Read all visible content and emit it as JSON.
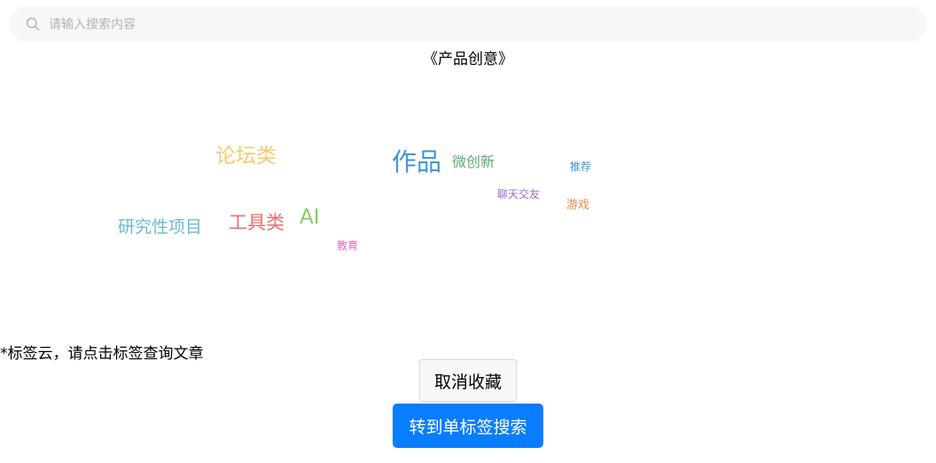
{
  "search": {
    "placeholder": "请输入搜索内容",
    "icon": "search-icon"
  },
  "page_title": "《产品创意》",
  "tag_cloud": {
    "tags": [
      {
        "label": "论坛类",
        "color": "#f8c96b"
      },
      {
        "label": "作品",
        "color": "#3a95e0"
      },
      {
        "label": "微创新",
        "color": "#5aab74"
      },
      {
        "label": "推荐",
        "color": "#3a95e0"
      },
      {
        "label": "聊天交友",
        "color": "#9b6cc4"
      },
      {
        "label": "游戏",
        "color": "#f08a4b"
      },
      {
        "label": "研究性项目",
        "color": "#6bb8d8"
      },
      {
        "label": "工具类",
        "color": "#ee6e6e"
      },
      {
        "label": "AI",
        "color": "#8cc866"
      },
      {
        "label": "教育",
        "color": "#e667c5"
      }
    ]
  },
  "hint": "*标签云，请点击标签查询文章",
  "buttons": {
    "uncollect": "取消收藏",
    "single_tag_search": "转到单标签搜索"
  }
}
